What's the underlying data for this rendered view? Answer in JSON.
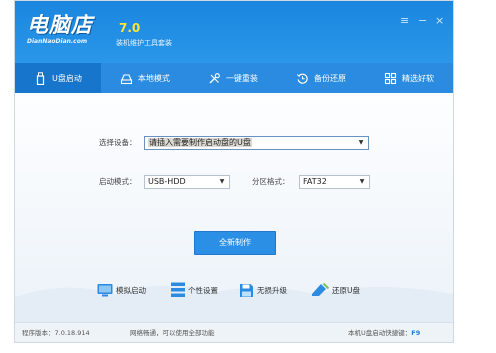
{
  "header": {
    "logo_text": "电脑店",
    "logo_sub": "DianNaoDian.com",
    "version": "7.0",
    "subtitle": "装机维护工具套装",
    "menu_glyph": "≡",
    "minimize_glyph": "−",
    "close_glyph": "×"
  },
  "nav": {
    "items": [
      {
        "label": "U盘启动",
        "icon": "usb-drive-icon",
        "active": true
      },
      {
        "label": "本地模式",
        "icon": "hard-disk-icon",
        "active": false
      },
      {
        "label": "一键重装",
        "icon": "tools-icon",
        "active": false
      },
      {
        "label": "备份还原",
        "icon": "restore-icon",
        "active": false
      },
      {
        "label": "精选好软",
        "icon": "apps-grid-icon",
        "active": false
      }
    ]
  },
  "form": {
    "device_label": "选择设备：",
    "device_value": "请插入需要制作启动盘的U盘",
    "boot_mode_label": "启动模式：",
    "boot_mode_value": "USB-HDD",
    "partition_label": "分区格式：",
    "partition_value": "FAT32",
    "arrow_glyph": "▼"
  },
  "actions": {
    "create_label": "全新制作"
  },
  "tools": [
    {
      "label": "模拟启动",
      "icon": "monitor-icon"
    },
    {
      "label": "个性设置",
      "icon": "settings-list-icon"
    },
    {
      "label": "无损升级",
      "icon": "save-disk-icon"
    },
    {
      "label": "还原U盘",
      "icon": "broom-icon"
    }
  ],
  "status": {
    "version_text": "程序版本：7.0.18.914",
    "network_text": "网络畅通，可以使用全部功能",
    "hotkey_text": "本机U盘启动快捷键：",
    "hotkey_value": "F9"
  },
  "colors": {
    "brand_blue": "#2b8be0",
    "active_tab": "#1875cc",
    "button_blue": "#2b8fe6",
    "version_yellow": "#ffe43a"
  }
}
